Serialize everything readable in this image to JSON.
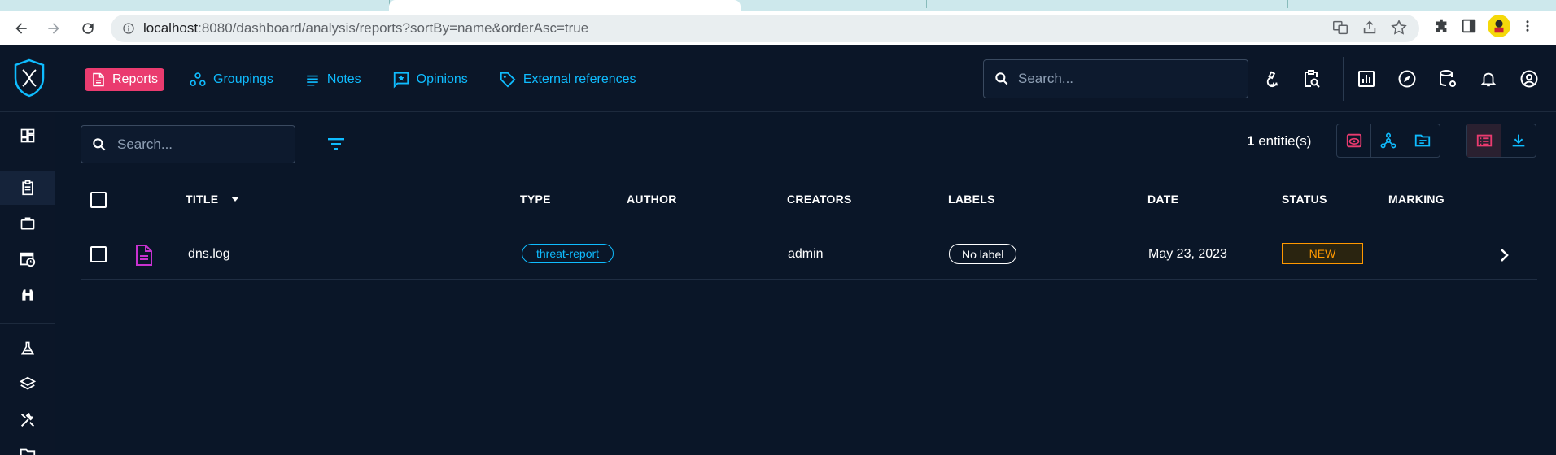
{
  "browser": {
    "url_host": "localhost",
    "url_rest": ":8080/dashboard/analysis/reports?sortBy=name&orderAsc=true"
  },
  "topnav": {
    "items": [
      {
        "label": "Reports",
        "icon": "report-icon",
        "active": true
      },
      {
        "label": "Groupings",
        "icon": "grouping-icon",
        "active": false
      },
      {
        "label": "Notes",
        "icon": "notes-icon",
        "active": false
      },
      {
        "label": "Opinions",
        "icon": "opinion-icon",
        "active": false
      },
      {
        "label": "External references",
        "icon": "tag-icon",
        "active": false
      }
    ],
    "search_placeholder": "Search..."
  },
  "toolbar": {
    "search_placeholder": "Search...",
    "count_number": "1",
    "count_suffix": " entitie(s)"
  },
  "table": {
    "columns": [
      "TITLE",
      "TYPE",
      "AUTHOR",
      "CREATORS",
      "LABELS",
      "DATE",
      "STATUS",
      "MARKING"
    ],
    "rows": [
      {
        "title": "dns.log",
        "type": "threat-report",
        "author": "",
        "creators": "admin",
        "labels": "No label",
        "date": "May 23, 2023",
        "status": "NEW",
        "marking": ""
      }
    ]
  },
  "colors": {
    "accent": "#0fbcff",
    "active_nav": "#ea3b6f",
    "background": "#0a1628",
    "status_new": "#ff9800",
    "report_icon": "#c832d0"
  }
}
